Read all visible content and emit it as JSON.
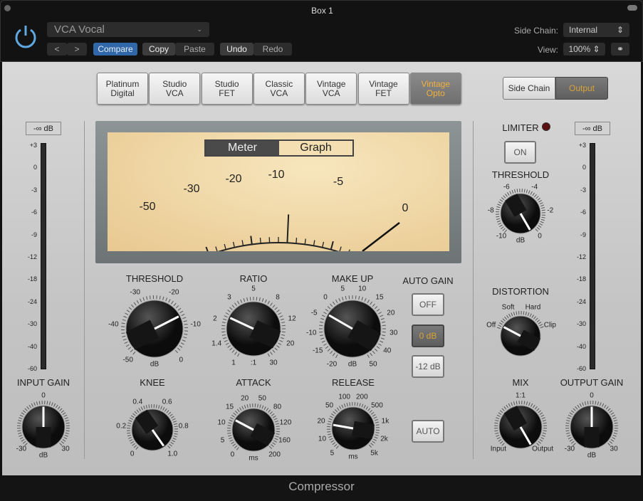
{
  "window": {
    "title": "Box 1"
  },
  "header": {
    "preset": "VCA Vocal",
    "prev": "<",
    "next": ">",
    "compare": "Compare",
    "copy": "Copy",
    "paste": "Paste",
    "undo": "Undo",
    "redo": "Redo",
    "side_chain_label": "Side Chain:",
    "side_chain_value": "Internal",
    "view_label": "View:",
    "view_value": "100%"
  },
  "models": [
    {
      "l1": "Platinum",
      "l2": "Digital"
    },
    {
      "l1": "Studio",
      "l2": "VCA"
    },
    {
      "l1": "Studio",
      "l2": "FET"
    },
    {
      "l1": "Classic",
      "l2": "VCA"
    },
    {
      "l1": "Vintage",
      "l2": "VCA"
    },
    {
      "l1": "Vintage",
      "l2": "FET"
    },
    {
      "l1": "Vintage",
      "l2": "Opto",
      "selected": true
    }
  ],
  "display_toggle": {
    "side_chain": "Side Chain",
    "output": "Output",
    "selected": "Output"
  },
  "vu": {
    "meter": "Meter",
    "graph": "Graph",
    "selected": "Meter",
    "scale": [
      "-50",
      "-30",
      "-20",
      "-10",
      "-5",
      "0"
    ]
  },
  "input_meter": {
    "peak": "-∞ dB",
    "scale": [
      "+3",
      "0",
      "-3",
      "-6",
      "-9",
      "-12",
      "-18",
      "-24",
      "-30",
      "-40",
      "-60"
    ]
  },
  "output_meter": {
    "peak": "-∞ dB",
    "scale": [
      "+3",
      "0",
      "-3",
      "-6",
      "-9",
      "-12",
      "-18",
      "-24",
      "-30",
      "-40",
      "-60"
    ]
  },
  "knobs": [
    {
      "name": "threshold",
      "label": "THRESHOLD",
      "unit": "dB",
      "ticks": [
        "-50",
        "-40",
        "-30",
        "-20",
        "-10",
        "0"
      ]
    },
    {
      "name": "ratio",
      "label": "RATIO",
      "unit": ":1",
      "ticks": [
        "1",
        "1.4",
        "2",
        "3",
        "5",
        "8",
        "12",
        "20",
        "30"
      ]
    },
    {
      "name": "make-up",
      "label": "MAKE UP",
      "unit": "dB",
      "ticks": [
        "-20",
        "-15",
        "-10",
        "-5",
        "0",
        "5",
        "10",
        "15",
        "20",
        "30",
        "40",
        "50"
      ]
    },
    {
      "name": "knee",
      "label": "KNEE",
      "unit": "",
      "ticks": [
        "0",
        "0.2",
        "0.4",
        "0.6",
        "0.8",
        "1.0"
      ]
    },
    {
      "name": "attack",
      "label": "ATTACK",
      "unit": "ms",
      "ticks": [
        "0",
        "5",
        "10",
        "15",
        "20",
        "50",
        "80",
        "120",
        "160",
        "200"
      ]
    },
    {
      "name": "release",
      "label": "RELEASE",
      "unit": "ms",
      "ticks": [
        "5",
        "10",
        "20",
        "50",
        "100",
        "200",
        "500",
        "1k",
        "2k",
        "5k"
      ]
    },
    {
      "name": "input-gain",
      "label": "INPUT GAIN",
      "unit": "dB",
      "ticks": [
        "-30",
        "0",
        "30"
      ]
    },
    {
      "name": "limiter-threshold",
      "label": "THRESHOLD",
      "unit": "dB",
      "ticks": [
        "-10",
        "-8",
        "-6",
        "-4",
        "-2",
        "0"
      ]
    },
    {
      "name": "distortion",
      "label": "DISTORTION",
      "unit": "",
      "ticks": [
        "Off",
        "Soft",
        "Hard",
        "Clip"
      ]
    },
    {
      "name": "mix",
      "label": "MIX",
      "unit": "",
      "ticks": [
        "Input",
        "1:1",
        "Output"
      ]
    },
    {
      "name": "output-gain",
      "label": "OUTPUT GAIN",
      "unit": "dB",
      "ticks": [
        "-30",
        "0",
        "30"
      ]
    }
  ],
  "auto_gain": {
    "label": "AUTO GAIN",
    "off": "OFF",
    "zero": "0 dB",
    "minus12": "-12 dB",
    "selected": "0 dB",
    "auto": "AUTO"
  },
  "limiter": {
    "label": "LIMITER",
    "on": "ON",
    "led_color": "#5a1010"
  },
  "footer": {
    "title": "Compressor"
  },
  "colors": {
    "accent": "#2f67a8",
    "selected_text": "#f2b03c",
    "vu_face": "#f0d9a6"
  }
}
